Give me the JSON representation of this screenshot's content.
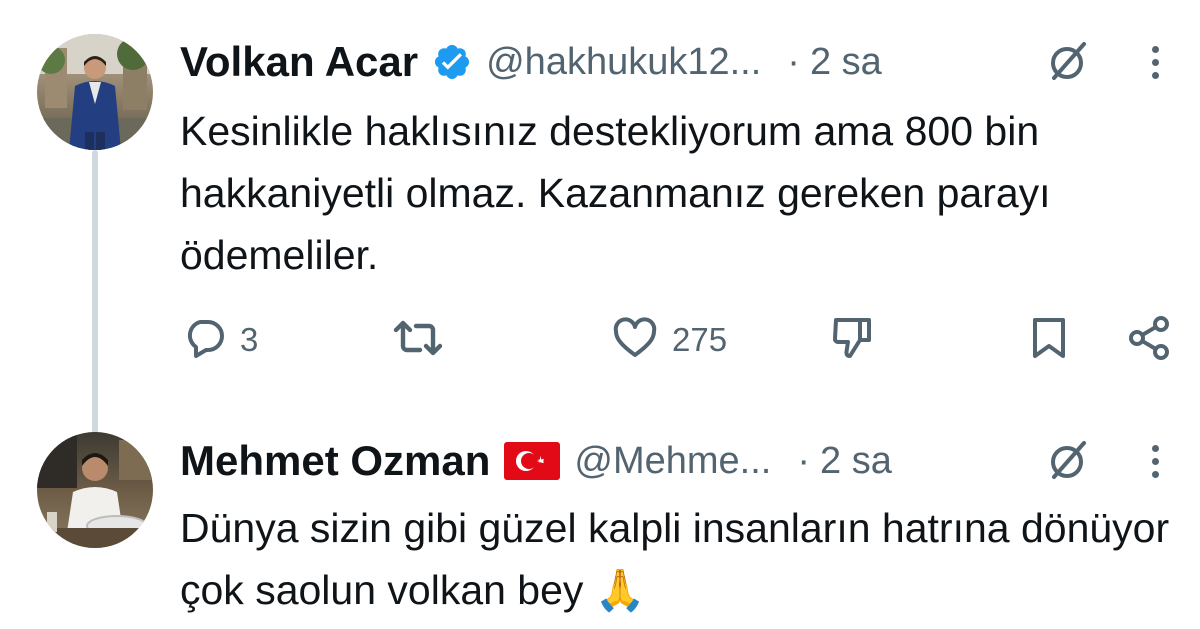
{
  "tweets": [
    {
      "name": "Volkan Acar",
      "handle": "@hakhukuk12...",
      "dot": "·",
      "time": "2 sa",
      "verified_color": "#1d9bf0",
      "text": "Kesinlikle haklısınız destekliyorum ama 800 bin hakkaniyetli olmaz. Kazanmanız gereken parayı ödemeliler.",
      "actions": {
        "reply_count": "3",
        "retweet_count": "",
        "like_count": "275"
      }
    },
    {
      "name": "Mehmet Ozman",
      "handle": "@Mehme...",
      "dot": "·",
      "time": "2 sa",
      "text": "Dünya sizin gibi güzel kalpli insanların hatrına dönüyor çok saolun volkan bey 🙏"
    }
  ],
  "icons": {
    "reply": "reply-icon",
    "retweet": "retweet-icon",
    "like": "heart-icon",
    "dislike": "thumbs-down-icon",
    "bookmark": "bookmark-icon",
    "share": "share-icon",
    "grok": "grok-icon",
    "more": "more-dots-icon",
    "flag": "turkey-flag-icon",
    "verified": "verified-badge-icon"
  },
  "colors": {
    "text_primary": "#0f1419",
    "text_secondary": "#536471",
    "thread_line": "#cfd9de",
    "verified": "#1d9bf0",
    "flag_red": "#e30a17"
  }
}
